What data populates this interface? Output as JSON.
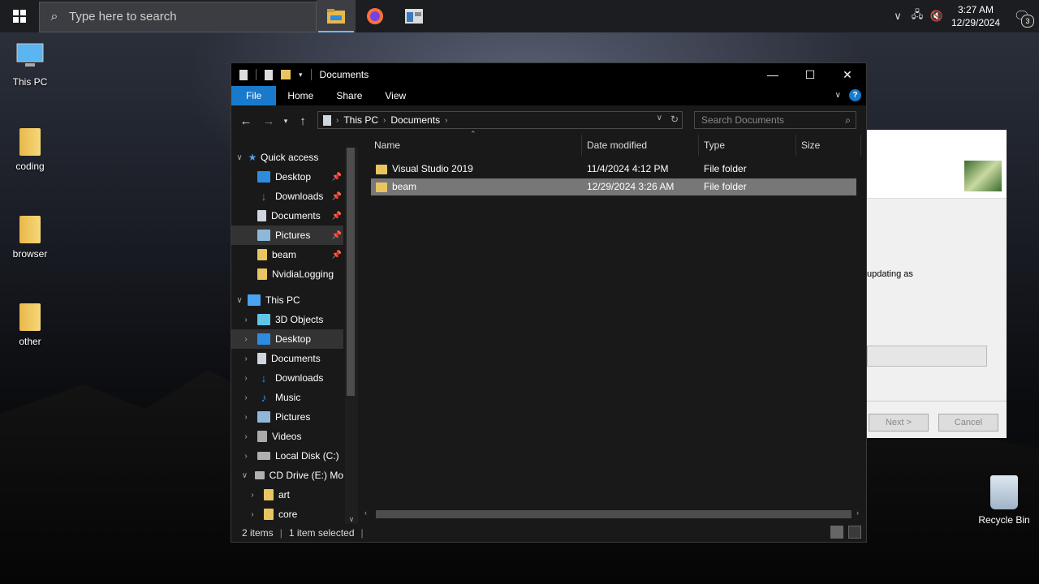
{
  "taskbar": {
    "search_placeholder": "Type here to search",
    "time": "3:27 AM",
    "date": "12/29/2024",
    "notification_count": "3"
  },
  "desktop": {
    "icons": [
      {
        "label": "This PC"
      },
      {
        "label": "coding"
      },
      {
        "label": "browser"
      },
      {
        "label": "other"
      }
    ],
    "recycle_bin": "Recycle Bin"
  },
  "background_dialog": {
    "text": "updating as",
    "next_label": "Next >",
    "cancel_label": "Cancel"
  },
  "explorer": {
    "title": "Documents",
    "ribbon_tabs": [
      "File",
      "Home",
      "Share",
      "View"
    ],
    "address": {
      "segments": [
        "This PC",
        "Documents"
      ]
    },
    "search_placeholder": "Search Documents",
    "nav_pane": [
      {
        "label": "Quick access",
        "icon": "star-icon",
        "color": "#4aa3f0"
      },
      {
        "label": "Desktop",
        "icon": "desktop-icon",
        "color": "#2e8ce0",
        "pinned": true
      },
      {
        "label": "Downloads",
        "icon": "download-icon",
        "color": "#2e8ce0",
        "pinned": true
      },
      {
        "label": "Documents",
        "icon": "document-icon",
        "color": "#cfd6de",
        "pinned": true
      },
      {
        "label": "Pictures",
        "icon": "pictures-icon",
        "color": "#8fb8d8",
        "pinned": true,
        "selected": true
      },
      {
        "label": "beam",
        "icon": "folder-icon",
        "color": "#e8c560",
        "pinned": true
      },
      {
        "label": "NvidiaLogging",
        "icon": "folder-icon",
        "color": "#e8c560"
      },
      {
        "label": "This PC",
        "icon": "computer-icon",
        "color": "#4aa3f0"
      },
      {
        "label": "3D Objects",
        "icon": "cube-icon",
        "color": "#5fc6e8"
      },
      {
        "label": "Desktop",
        "icon": "desktop-icon",
        "color": "#2e8ce0",
        "selected": true
      },
      {
        "label": "Documents",
        "icon": "document-icon",
        "color": "#cfd6de"
      },
      {
        "label": "Downloads",
        "icon": "download-icon",
        "color": "#2e8ce0"
      },
      {
        "label": "Music",
        "icon": "music-icon",
        "color": "#2e8ce0"
      },
      {
        "label": "Pictures",
        "icon": "pictures-icon",
        "color": "#8fb8d8"
      },
      {
        "label": "Videos",
        "icon": "video-icon",
        "color": "#aaaaaa"
      },
      {
        "label": "Local Disk (C:)",
        "icon": "drive-icon",
        "color": "#b0b0b0"
      },
      {
        "label": "CD Drive (E:) Mo",
        "icon": "cd-drive-icon",
        "color": "#b0b0b0"
      },
      {
        "label": "art",
        "icon": "folder-icon",
        "color": "#e8c560"
      },
      {
        "label": "core",
        "icon": "folder-icon",
        "color": "#e8c560"
      }
    ],
    "columns": [
      "Name",
      "Date modified",
      "Type",
      "Size"
    ],
    "files": [
      {
        "name": "Visual Studio 2019",
        "date": "11/4/2024 4:12 PM",
        "type": "File folder",
        "size": ""
      },
      {
        "name": "beam",
        "date": "12/29/2024 3:26 AM",
        "type": "File folder",
        "size": "",
        "selected": true
      }
    ],
    "status": {
      "count": "2 items",
      "selection": "1 item selected"
    }
  }
}
